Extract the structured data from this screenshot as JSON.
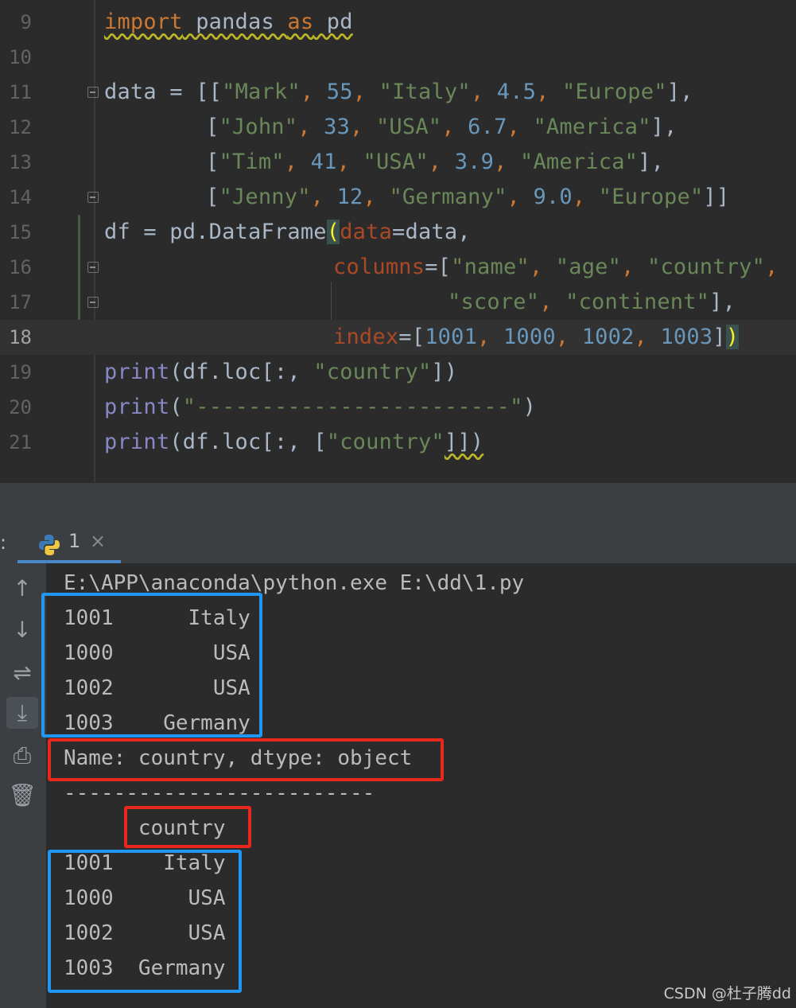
{
  "editor": {
    "lines": [
      {
        "n": "9"
      },
      {
        "n": "10"
      },
      {
        "n": "11"
      },
      {
        "n": "12"
      },
      {
        "n": "13"
      },
      {
        "n": "14"
      },
      {
        "n": "15"
      },
      {
        "n": "16"
      },
      {
        "n": "17"
      },
      {
        "n": "18"
      },
      {
        "n": "19"
      },
      {
        "n": "20"
      },
      {
        "n": "21"
      }
    ],
    "code": {
      "l9": [
        "import",
        " pandas ",
        "as",
        " pd"
      ],
      "l11": [
        "data = [[",
        "\"Mark\"",
        ", ",
        "55",
        ", ",
        "\"Italy\"",
        ", ",
        "4.5",
        ", ",
        "\"Europe\"",
        "],"
      ],
      "l12": [
        "[",
        "\"John\"",
        ", ",
        "33",
        ", ",
        "\"USA\"",
        ", ",
        "6.7",
        ", ",
        "\"America\"",
        "],"
      ],
      "l13": [
        "[",
        "\"Tim\"",
        ", ",
        "41",
        ", ",
        "\"USA\"",
        ", ",
        "3.9",
        ", ",
        "\"America\"",
        "],"
      ],
      "l14": [
        "[",
        "\"Jenny\"",
        ", ",
        "12",
        ", ",
        "\"Germany\"",
        ", ",
        "9.0",
        ", ",
        "\"Europe\"",
        "]]"
      ],
      "l15": [
        "df = pd.DataFrame",
        "(",
        "data",
        "=data,"
      ],
      "l16": [
        "columns",
        "=[",
        "\"name\"",
        ", ",
        "\"age\"",
        ", ",
        "\"country\"",
        ","
      ],
      "l17": [
        "\"score\"",
        ", ",
        "\"continent\"",
        "],"
      ],
      "l18": [
        "index",
        "=[",
        "1001",
        ", ",
        "1000",
        ", ",
        "1002",
        ", ",
        "1003",
        "]",
        ")"
      ],
      "l19": [
        "print",
        "(df.loc[:, ",
        "\"country\"",
        "])"
      ],
      "l20": [
        "print",
        "(",
        "\"------------------------\"",
        ")"
      ],
      "l21": [
        "print",
        "(df.loc[:, [",
        "\"country\"",
        "]])"
      ]
    }
  },
  "run_panel": {
    "colon": ":",
    "tab_label": "1",
    "tab_close": "×",
    "tools": {
      "up": "↑",
      "down": "↓",
      "wrap": "⇌",
      "scroll": "⤓",
      "print": "⎙",
      "trash": "🗑"
    }
  },
  "console": {
    "lines": [
      "E:\\APP\\anaconda\\python.exe E:\\dd\\1.py",
      "1001      Italy",
      "1000        USA",
      "1002        USA",
      "1003    Germany",
      "Name: country, dtype: object",
      "-------------------------",
      "      country",
      "1001    Italy",
      "1000      USA",
      "1002      USA",
      "1003  Germany"
    ]
  },
  "watermark": "CSDN @杜子腾dd",
  "colors": {
    "keyword": "#cc7832",
    "string": "#6a8759",
    "number": "#6897bb",
    "param": "#aa4926",
    "highlight_blue": "#2196f3",
    "highlight_red": "#e8281d"
  }
}
